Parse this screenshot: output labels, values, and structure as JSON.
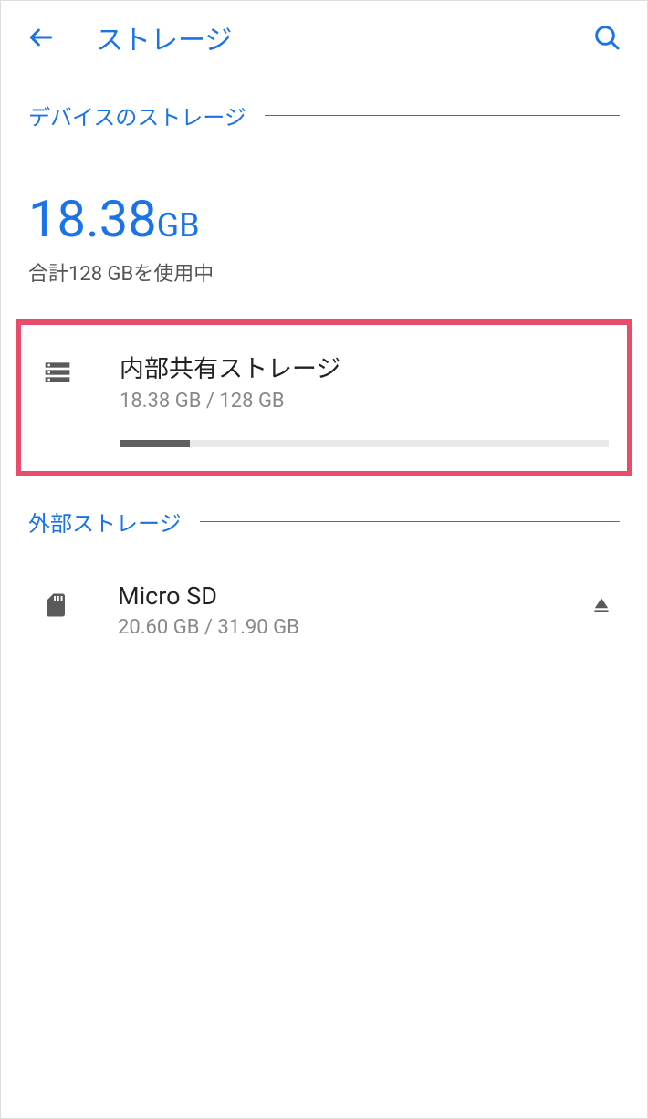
{
  "header": {
    "title": "ストレージ"
  },
  "device_storage": {
    "section_label": "デバイスのストレージ",
    "usage_value": "18.38",
    "usage_unit": "GB",
    "usage_subtext": "合計128 GBを使用中"
  },
  "internal": {
    "title": "内部共有ストレージ",
    "subtitle": "18.38 GB / 128 GB",
    "progress_percent": 14.4
  },
  "external_storage": {
    "section_label": "外部ストレージ"
  },
  "microsd": {
    "title": "Micro SD",
    "subtitle": "20.60 GB / 31.90 GB"
  }
}
